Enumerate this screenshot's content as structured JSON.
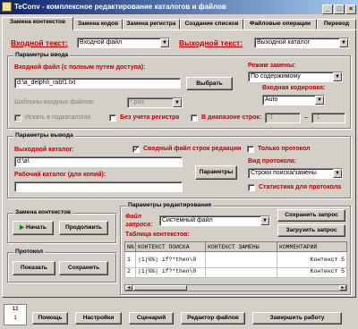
{
  "window": {
    "title": "TeConv - комплексное редактирование каталогов и файлов"
  },
  "tabs": [
    {
      "label": "Замена контекстов"
    },
    {
      "label": "Замена кодов"
    },
    {
      "label": "Замена регистра"
    },
    {
      "label": "Создание списков"
    },
    {
      "label": "Файловые операции"
    },
    {
      "label": "Перевод"
    }
  ],
  "top": {
    "input_text_label": "Входной текст:",
    "input_text_value": "Входной файл",
    "output_text_label": "Выходной текст:",
    "output_text_value": "Выходной каталог"
  },
  "input_params": {
    "title": "Параметры ввода",
    "input_file_label": "Входной файл (с полным путем доступа):",
    "input_file_value": "d:\\a_delphi\\_rabf1.txt",
    "select_button": "Выбрать",
    "mask_label": "Шаблоны входных файлов:",
    "mask_value": "*.pas",
    "subdir_label": "Искать в подкаталогах",
    "nocase_label": "Без учета регистра",
    "range_label": "В диапазоне строк:",
    "range_from": "-1",
    "range_dash": "–",
    "range_to": "-1",
    "replace_mode_label": "Режим замены:",
    "replace_mode_value": "По содержимому",
    "encoding_label": "Входная кодировка:",
    "encoding_value": "Auto"
  },
  "output_params": {
    "title": "Параметры вывода",
    "output_file_label": "Выходной каталог:",
    "output_file_value": "d:\\a\\",
    "workdir_label": "Рабочий каталог (для копий):",
    "workdir_value": "",
    "summary_label": "Сводный файл строк редакции",
    "params_button": "Параметры",
    "only_protocol_label": "Только протокол",
    "output_view_label": "Вид протокола:",
    "output_view_value": "Строки поиска/замены",
    "stats_label": "Статистика для протокола"
  },
  "replace_contexts": {
    "title": "Замена контекстов",
    "start_button": "Начать",
    "continue_button": "Продолжить"
  },
  "protocol": {
    "title": "Протокол",
    "show_button": "Показать",
    "save_button": "Сохранить"
  },
  "edit_params": {
    "title": "Параметры редактирования",
    "query_file_label": "Файл запроса:",
    "query_file_value": "Системный файл",
    "save_query_button": "Сохранить запрос",
    "load_query_button": "Загрузить запрос",
    "table_label": "Таблица контекстов:",
    "columns": [
      "NN",
      "КОНТЕКСТ ПОИСКА",
      "КОНТЕКСТ ЗАМЕНЫ",
      "КОММЕНТАРИЙ"
    ],
    "rows": [
      [
        "1",
        "|1|%%| if?*then\\0",
        "",
        "Контекст 5"
      ],
      [
        "2",
        "|1|%%| if?*then\\0",
        "",
        "Контекст 5"
      ]
    ]
  },
  "bottom": {
    "calendar_top": "12",
    "calendar_bottom": "1",
    "help": "Помощь",
    "settings": "Настройки",
    "script": "Сценарий",
    "file_editor": "Редактор файлов",
    "finish": "Завершить работу"
  }
}
